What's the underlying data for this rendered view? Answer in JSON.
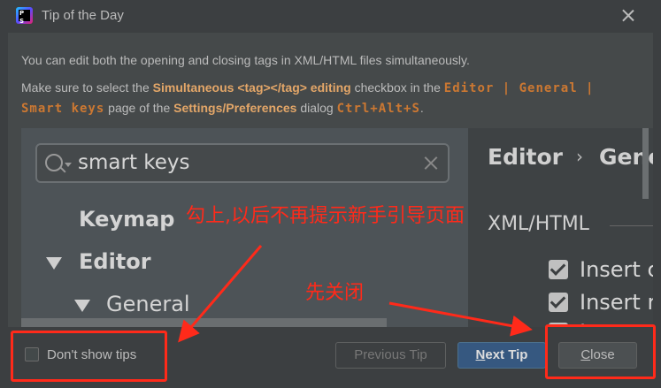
{
  "window": {
    "title": "Tip of the Day",
    "icon_letters": [
      "P",
      "S"
    ]
  },
  "tip": {
    "line1": "You can edit both the opening and closing tags in XML/HTML files simultaneously.",
    "line2_a": "Make sure to select the ",
    "line2_b": "Simultaneous <tag></tag> editing",
    "line2_c": " checkbox in the ",
    "path_1": "Editor | General |",
    "path_2": "Smart keys",
    "line3_a": " page of the ",
    "line3_b": "Settings/Preferences",
    "line3_c": " dialog ",
    "shortcut": "Ctrl+Alt+S",
    "line3_d": "."
  },
  "screenshot": {
    "search_value": "smart keys",
    "tree": [
      "Keymap",
      "Editor",
      "General"
    ],
    "breadcrumb": [
      "Editor",
      "Gene"
    ],
    "section": "XML/HTML",
    "options": [
      {
        "label": "Insert clo",
        "checked": true
      },
      {
        "label": "Insert re",
        "checked": true
      },
      {
        "label": "I",
        "checked": true
      }
    ]
  },
  "footer": {
    "dont_show": "Don't show tips",
    "prev": "Previous Tip",
    "next_pre": "",
    "next_u": "N",
    "next_post": "ext Tip",
    "close_pre": "",
    "close_u": "C",
    "close_post": "lose"
  },
  "annotations": {
    "checkbox_note": "勾上,以后不再提示新手引导页面",
    "close_note": "先关闭",
    "color": "#ff2a1a"
  }
}
